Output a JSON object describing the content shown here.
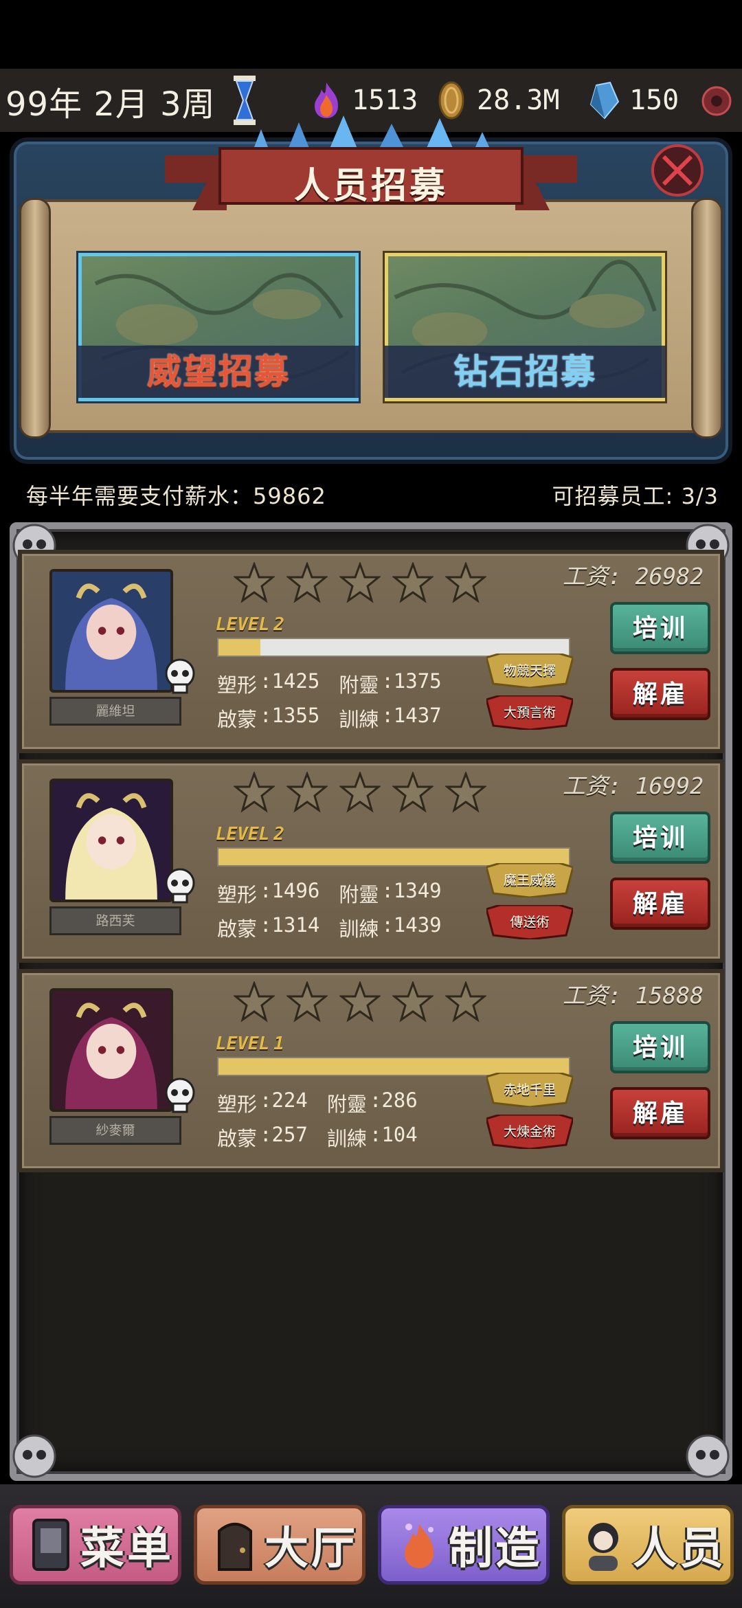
{
  "status_bar": {
    "date": "99年 2月 3周",
    "flame_value": "1513",
    "coin_value": "28.3M",
    "gem_value": "150",
    "icons": [
      "hourglass-icon",
      "flame-icon",
      "coin-icon",
      "gem-icon",
      "settings-icon"
    ]
  },
  "recruit": {
    "title": "人员招募",
    "prestige_label": "威望招募",
    "diamond_label": "钻石招募"
  },
  "info": {
    "salary_text": "每半年需要支付薪水：59862",
    "slots_text": "可招募员工: 3/3"
  },
  "employees": [
    {
      "name": "麗維坦",
      "stars": 5,
      "level_label": "LEVEL",
      "level": "2",
      "xp_fraction": 0.12,
      "stats": [
        {
          "k": "塑形",
          "v": "1425"
        },
        {
          "k": "附靈",
          "v": "1375"
        },
        {
          "k": "啟蒙",
          "v": "1355"
        },
        {
          "k": "訓練",
          "v": "1437"
        }
      ],
      "skills": [
        {
          "label": "物競天擇",
          "color": "gold"
        },
        {
          "label": "大預言術",
          "color": "red"
        }
      ],
      "wage": "工资: 26982",
      "train_label": "培训",
      "fire_label": "解雇"
    },
    {
      "name": "路西芙",
      "stars": 5,
      "level_label": "LEVEL",
      "level": "2",
      "xp_fraction": 1.0,
      "stats": [
        {
          "k": "塑形",
          "v": "1496"
        },
        {
          "k": "附靈",
          "v": "1349"
        },
        {
          "k": "啟蒙",
          "v": "1314"
        },
        {
          "k": "訓練",
          "v": "1439"
        }
      ],
      "skills": [
        {
          "label": "魔王威儀",
          "color": "gold"
        },
        {
          "label": "傳送術",
          "color": "red"
        }
      ],
      "wage": "工资: 16992",
      "train_label": "培训",
      "fire_label": "解雇"
    },
    {
      "name": "紗麥爾",
      "stars": 5,
      "level_label": "LEVEL",
      "level": "1",
      "xp_fraction": 1.0,
      "stats": [
        {
          "k": "塑形",
          "v": "224"
        },
        {
          "k": "附靈",
          "v": "286"
        },
        {
          "k": "啟蒙",
          "v": "257"
        },
        {
          "k": "訓練",
          "v": "104"
        }
      ],
      "skills": [
        {
          "label": "赤地千里",
          "color": "gold"
        },
        {
          "label": "大煉金術",
          "color": "red"
        }
      ],
      "wage": "工资: 15888",
      "train_label": "培训",
      "fire_label": "解雇"
    }
  ],
  "nav": {
    "menu": "菜单",
    "hall": "大厅",
    "craft": "制造",
    "staff": "人员"
  },
  "colors": {
    "train_button": "#4a9f86",
    "fire_button": "#b2302b",
    "xp_fill": "#e3c566",
    "panel_blue": "#29445f"
  }
}
